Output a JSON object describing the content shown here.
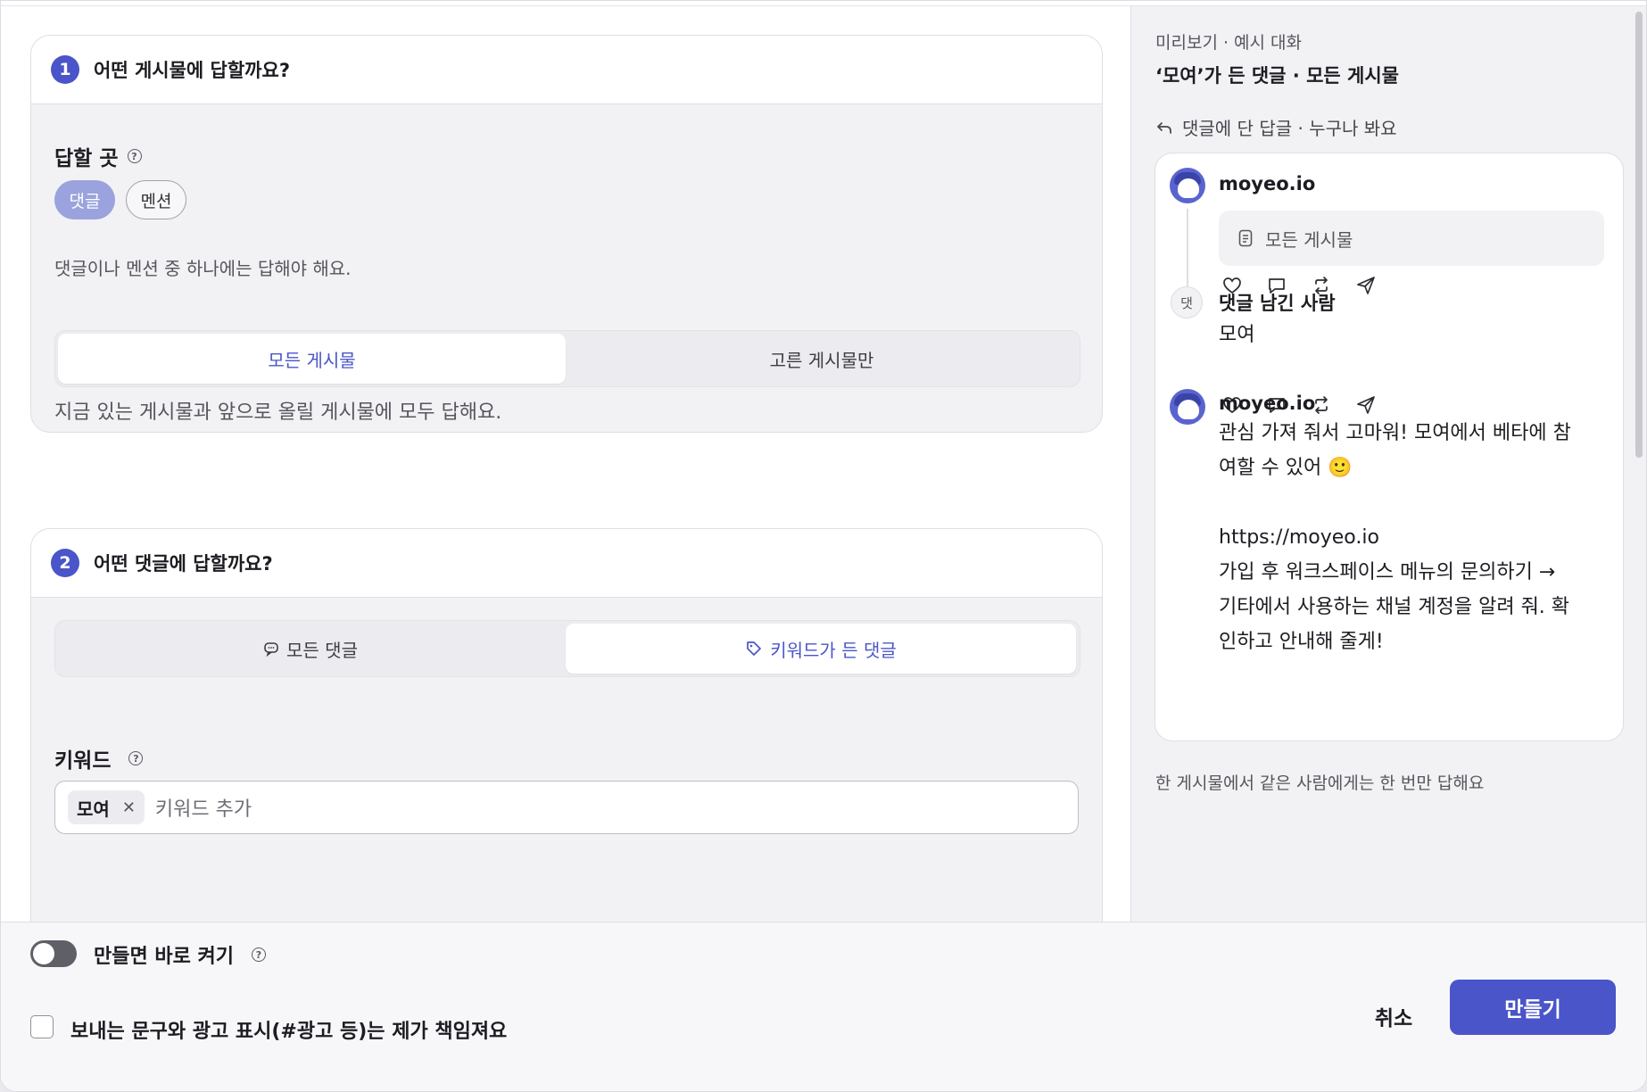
{
  "section1": {
    "step": "1",
    "title": "어떤 게시물에 답할까요?",
    "reply_to_label": "답할 곳",
    "reply_to_options": [
      "댓글",
      "멘션"
    ],
    "reply_to_hint": "댓글이나 멘션 중 하나에는 답해야 해요.",
    "post_scope_options": [
      "모든 게시물",
      "고른 게시물만"
    ],
    "post_scope_hint": "지금 있는 게시물과 앞으로 올릴 게시물에 모두 답해요."
  },
  "section2": {
    "step": "2",
    "title": "어떤 댓글에 답할까요?",
    "comment_scope_options": [
      "모든 댓글",
      "키워드가 든 댓글"
    ],
    "keyword_label": "키워드",
    "keywords": [
      "모여"
    ],
    "keyword_placeholder": "키워드 추가"
  },
  "preview": {
    "subtitle": "미리보기 · 예시 대화",
    "title": "‘모여’가 든 댓글 · 모든 게시물",
    "mode": "댓글에 단 답글 · 누구나 봐요",
    "post_author": "moyeo.io",
    "post_box_text": "모든 게시물",
    "commenter_avatar": "댓",
    "commenter_name": "댓글 남긴 사람",
    "comment_text": "모여",
    "reply_author": "moyeo.io",
    "reply_lines": [
      "관심 가져 줘서 고마워! 모여에서 베타에 참",
      "여할 수 있어 🙂",
      "",
      "https://moyeo.io",
      "가입 후 워크스페이스 메뉴의 문의하기 →",
      "기타에서 사용하는 채널 계정을 알려 줘. 확",
      "인하고 안내해 줄게!"
    ],
    "note": "한 게시물에서 같은 사람에게는 한 번만 답해요"
  },
  "footer": {
    "toggle_label": "만들면 바로 켜기",
    "checkbox_label": "보내는 문구와 광고 표시(#광고 등)는 제가 책임져요",
    "cancel_label": "취소",
    "create_label": "만들기"
  },
  "colors": {
    "accent": "#4a55c9",
    "accent_light": "#9aa3dd",
    "panel_bg": "#f2f2f5"
  },
  "icons": [
    "help-icon",
    "reply-arrow-icon",
    "document-icon",
    "heart-icon",
    "comment-icon",
    "repost-icon",
    "send-icon",
    "speech-bubble-icon",
    "tag-icon",
    "close-icon"
  ]
}
